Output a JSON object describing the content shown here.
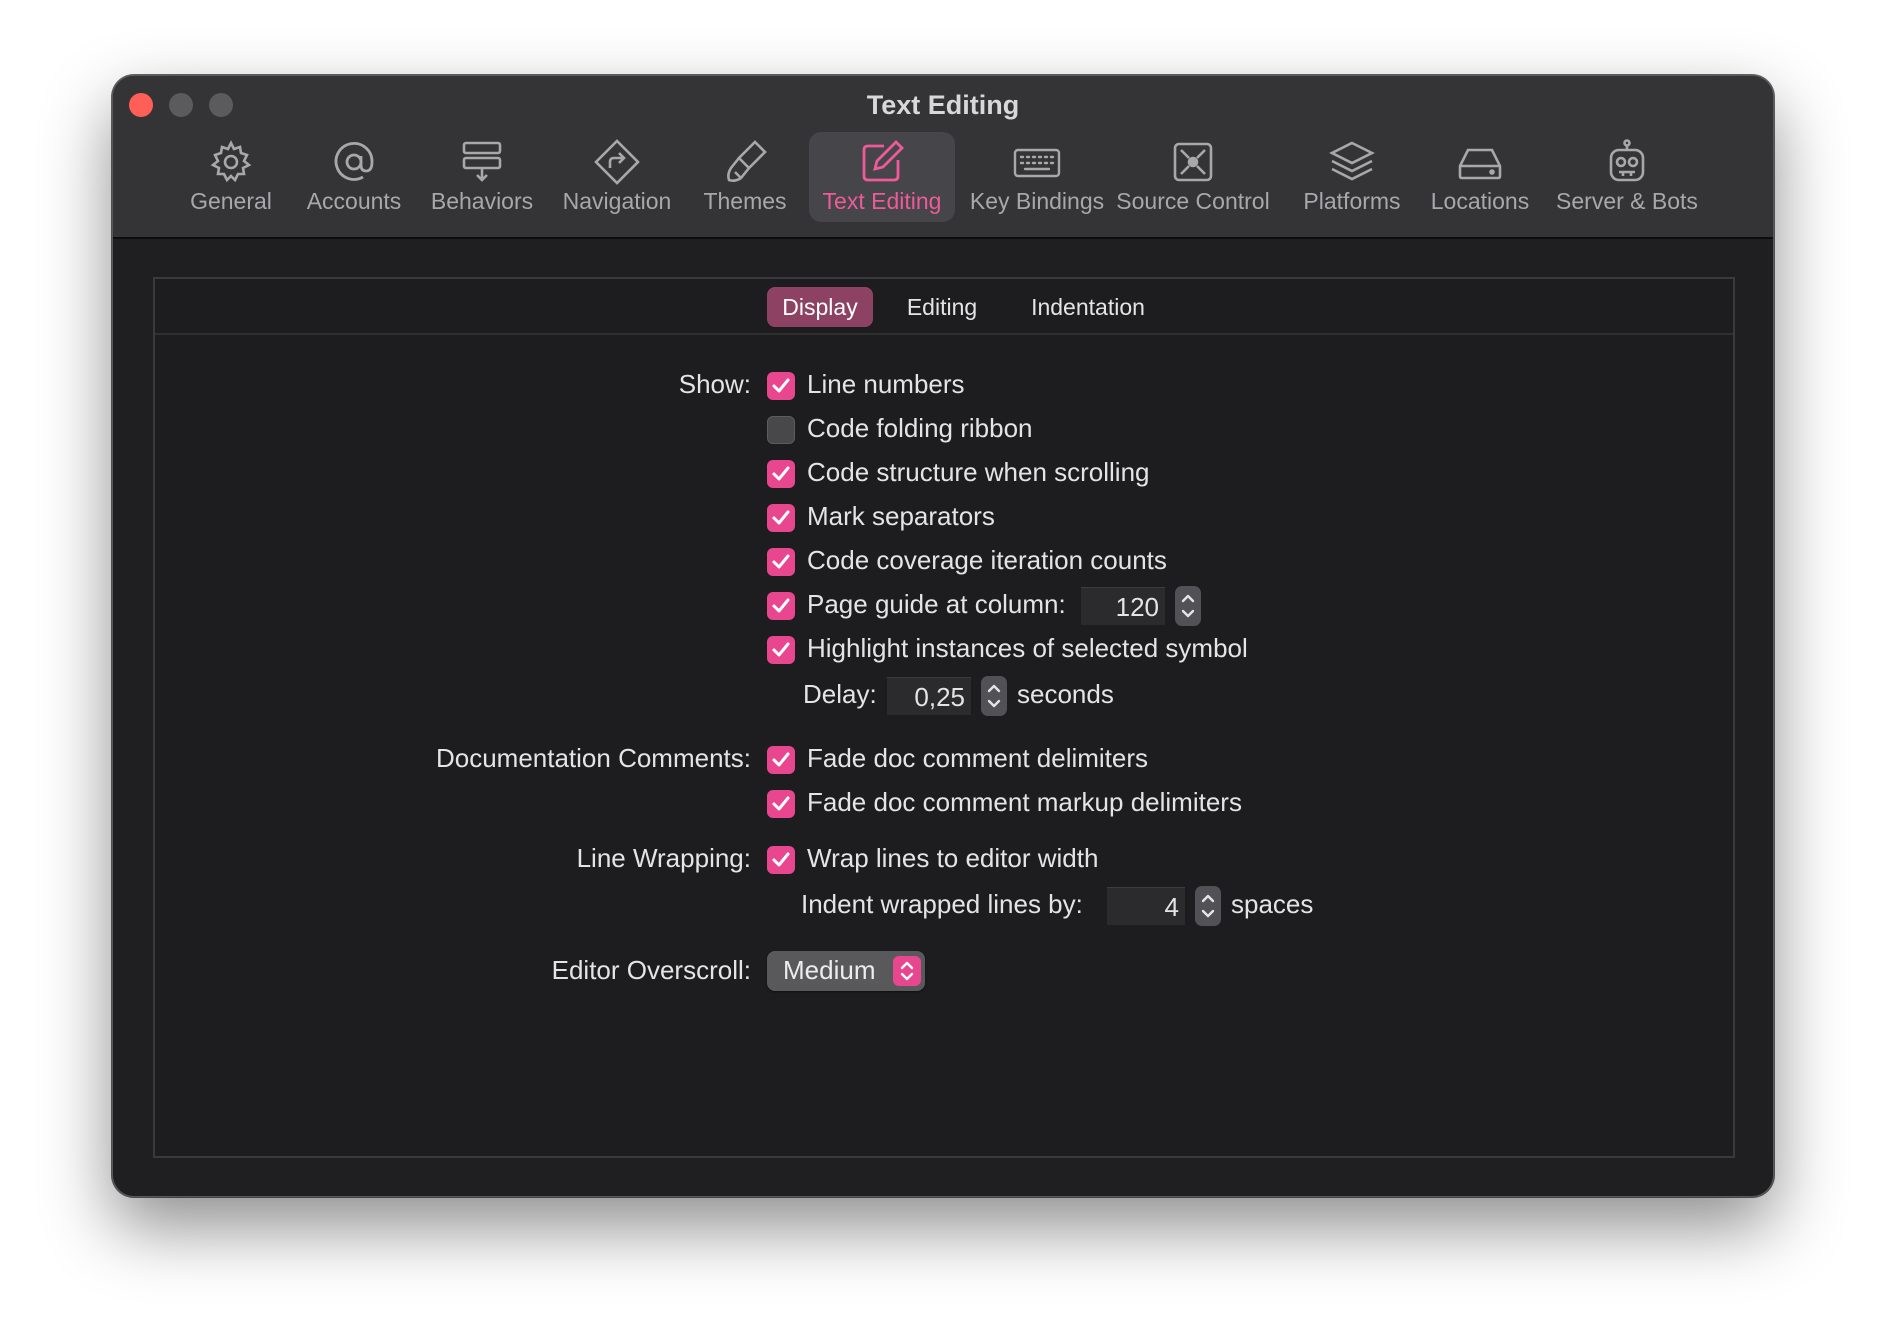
{
  "window": {
    "title": "Text Editing"
  },
  "toolbar": {
    "items": [
      {
        "label": "General",
        "icon": "gear-icon"
      },
      {
        "label": "Accounts",
        "icon": "at-icon"
      },
      {
        "label": "Behaviors",
        "icon": "behaviors-icon"
      },
      {
        "label": "Navigation",
        "icon": "navigation-icon"
      },
      {
        "label": "Themes",
        "icon": "paintbrush-icon"
      },
      {
        "label": "Text Editing",
        "icon": "pencil-square-icon",
        "selected": true
      },
      {
        "label": "Key Bindings",
        "icon": "keyboard-icon"
      },
      {
        "label": "Source Control",
        "icon": "source-control-icon"
      },
      {
        "label": "Platforms",
        "icon": "layers-icon"
      },
      {
        "label": "Locations",
        "icon": "drive-icon"
      },
      {
        "label": "Server & Bots",
        "icon": "robot-icon"
      }
    ]
  },
  "tabs": {
    "items": [
      {
        "label": "Display",
        "selected": true
      },
      {
        "label": "Editing"
      },
      {
        "label": "Indentation"
      }
    ]
  },
  "show": {
    "label": "Show:",
    "options": [
      {
        "label": "Line numbers",
        "checked": true
      },
      {
        "label": "Code folding ribbon",
        "checked": false
      },
      {
        "label": "Code structure when scrolling",
        "checked": true
      },
      {
        "label": "Mark separators",
        "checked": true
      },
      {
        "label": "Code coverage iteration counts",
        "checked": true
      },
      {
        "label": "Page guide at column:",
        "checked": true
      },
      {
        "label": "Highlight instances of selected symbol",
        "checked": true
      }
    ],
    "page_guide_value": "120",
    "delay_label": "Delay:",
    "delay_value": "0,25",
    "delay_unit": "seconds"
  },
  "doc_comments": {
    "label": "Documentation Comments:",
    "options": [
      {
        "label": "Fade doc comment delimiters",
        "checked": true
      },
      {
        "label": "Fade doc comment markup delimiters",
        "checked": true
      }
    ]
  },
  "line_wrapping": {
    "label": "Line Wrapping:",
    "option": {
      "label": "Wrap lines to editor width",
      "checked": true
    },
    "indent_label": "Indent wrapped lines by:",
    "indent_value": "4",
    "indent_unit": "spaces"
  },
  "overscroll": {
    "label": "Editor Overscroll:",
    "value": "Medium"
  },
  "colors": {
    "accent": "#e8478f",
    "selected_tab": "#8e4263",
    "window_bg": "#1f1f21",
    "titlebar_bg": "#343437"
  }
}
